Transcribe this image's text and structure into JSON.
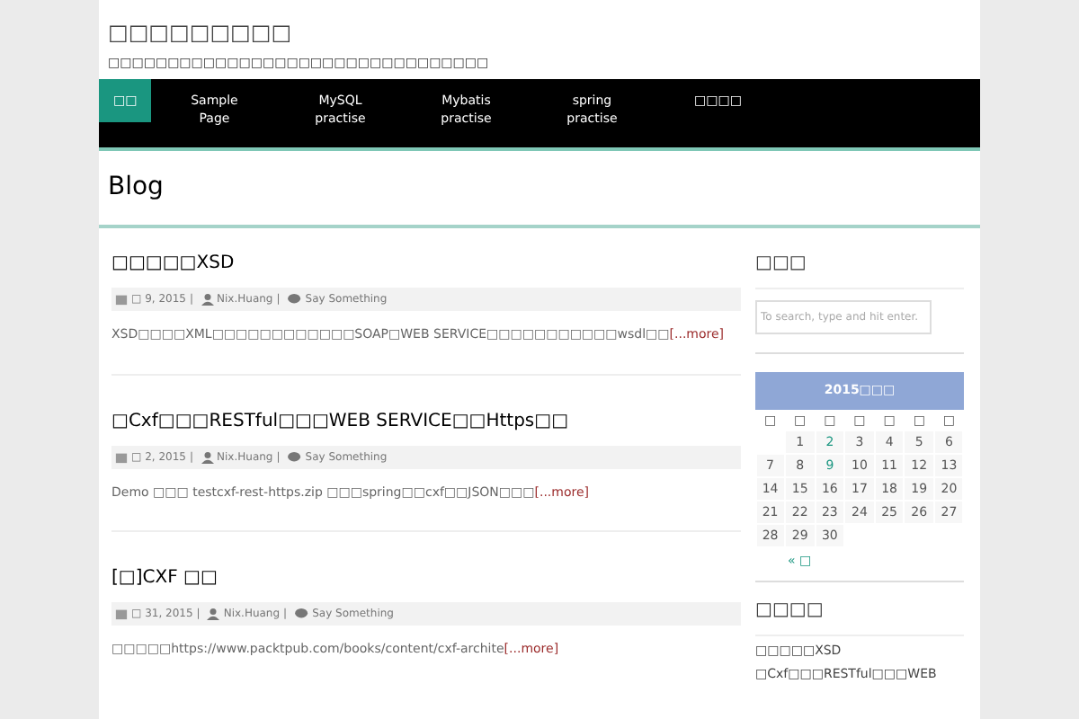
{
  "site": {
    "title": "□□□□□□□□□",
    "tagline": "□□□□□□□□□□□□□□□□□□□□□□□□□□□□□□□□"
  },
  "nav": [
    {
      "label": "□□",
      "selected": true
    },
    {
      "label": "Sample Page",
      "selected": false
    },
    {
      "label": "MySQL practise",
      "selected": false
    },
    {
      "label": "Mybatis practise",
      "selected": false
    },
    {
      "label": "spring practise",
      "selected": false
    },
    {
      "label": "□□□□",
      "selected": false
    }
  ],
  "page_title": "Blog",
  "meta_separators": [
    "|",
    "|"
  ],
  "posts": [
    {
      "title": "□□□□□XSD",
      "date": "□ 9, 2015",
      "author": "Nix.Huang",
      "category": "Say Something",
      "excerpt": "XSD□□□□XML□□□□□□□□□□□□SOAP□WEB SERVICE□□□□□□□□□□□wsdl□□",
      "more": "[...more]"
    },
    {
      "title": "□Cxf□□□RESTful□□□WEB SERVICE□□Https□□",
      "date": "□ 2, 2015",
      "author": "Nix.Huang",
      "category": "Say Something",
      "excerpt": "Demo □□□ testcxf-rest-https.zip □□□spring□□cxf□□JSON□□□",
      "more": "[...more]"
    },
    {
      "title": "[□]CXF □□",
      "date": "□ 31, 2015",
      "author": "Nix.Huang",
      "category": "Say Something",
      "excerpt": "□□□□□https://www.packtpub.com/books/content/cxf-archite",
      "more": "[...more]"
    }
  ],
  "sidebar": {
    "search": {
      "heading": "□□□",
      "placeholder": "To search, type and hit enter."
    },
    "calendar": {
      "caption": "2015□□□",
      "weekdays": [
        "□",
        "□",
        "□",
        "□",
        "□",
        "□",
        "□"
      ],
      "weeks": [
        [
          {
            "kind": "empty"
          },
          {
            "day": "1",
            "linked": false
          },
          {
            "day": "2",
            "linked": true
          },
          {
            "day": "3",
            "linked": false
          },
          {
            "day": "4",
            "linked": false
          },
          {
            "day": "5",
            "linked": false
          },
          {
            "day": "6",
            "linked": false
          }
        ],
        [
          {
            "day": "7",
            "linked": false
          },
          {
            "day": "8",
            "linked": false
          },
          {
            "day": "9",
            "linked": true
          },
          {
            "day": "10",
            "linked": false
          },
          {
            "day": "11",
            "linked": false
          },
          {
            "day": "12",
            "linked": false
          },
          {
            "day": "13",
            "linked": false
          }
        ],
        [
          {
            "day": "14",
            "linked": false
          },
          {
            "day": "15",
            "linked": false
          },
          {
            "day": "16",
            "linked": false
          },
          {
            "day": "17",
            "linked": false
          },
          {
            "day": "18",
            "linked": false
          },
          {
            "day": "19",
            "linked": false
          },
          {
            "day": "20",
            "linked": false
          }
        ],
        [
          {
            "day": "21",
            "linked": false
          },
          {
            "day": "22",
            "linked": false
          },
          {
            "day": "23",
            "linked": false
          },
          {
            "day": "24",
            "linked": false
          },
          {
            "day": "25",
            "linked": false
          },
          {
            "day": "26",
            "linked": false
          },
          {
            "day": "27",
            "linked": false
          }
        ],
        [
          {
            "day": "28",
            "linked": false
          },
          {
            "day": "29",
            "linked": false
          },
          {
            "day": "30",
            "linked": false
          },
          {
            "kind": "empty"
          },
          {
            "kind": "empty"
          },
          {
            "kind": "empty"
          },
          {
            "kind": "empty"
          }
        ]
      ],
      "prev": "« □"
    },
    "recent": {
      "heading": "□□□□",
      "items": [
        "□□□□□XSD",
        "□Cxf□□□RESTful□□□WEB"
      ]
    }
  }
}
